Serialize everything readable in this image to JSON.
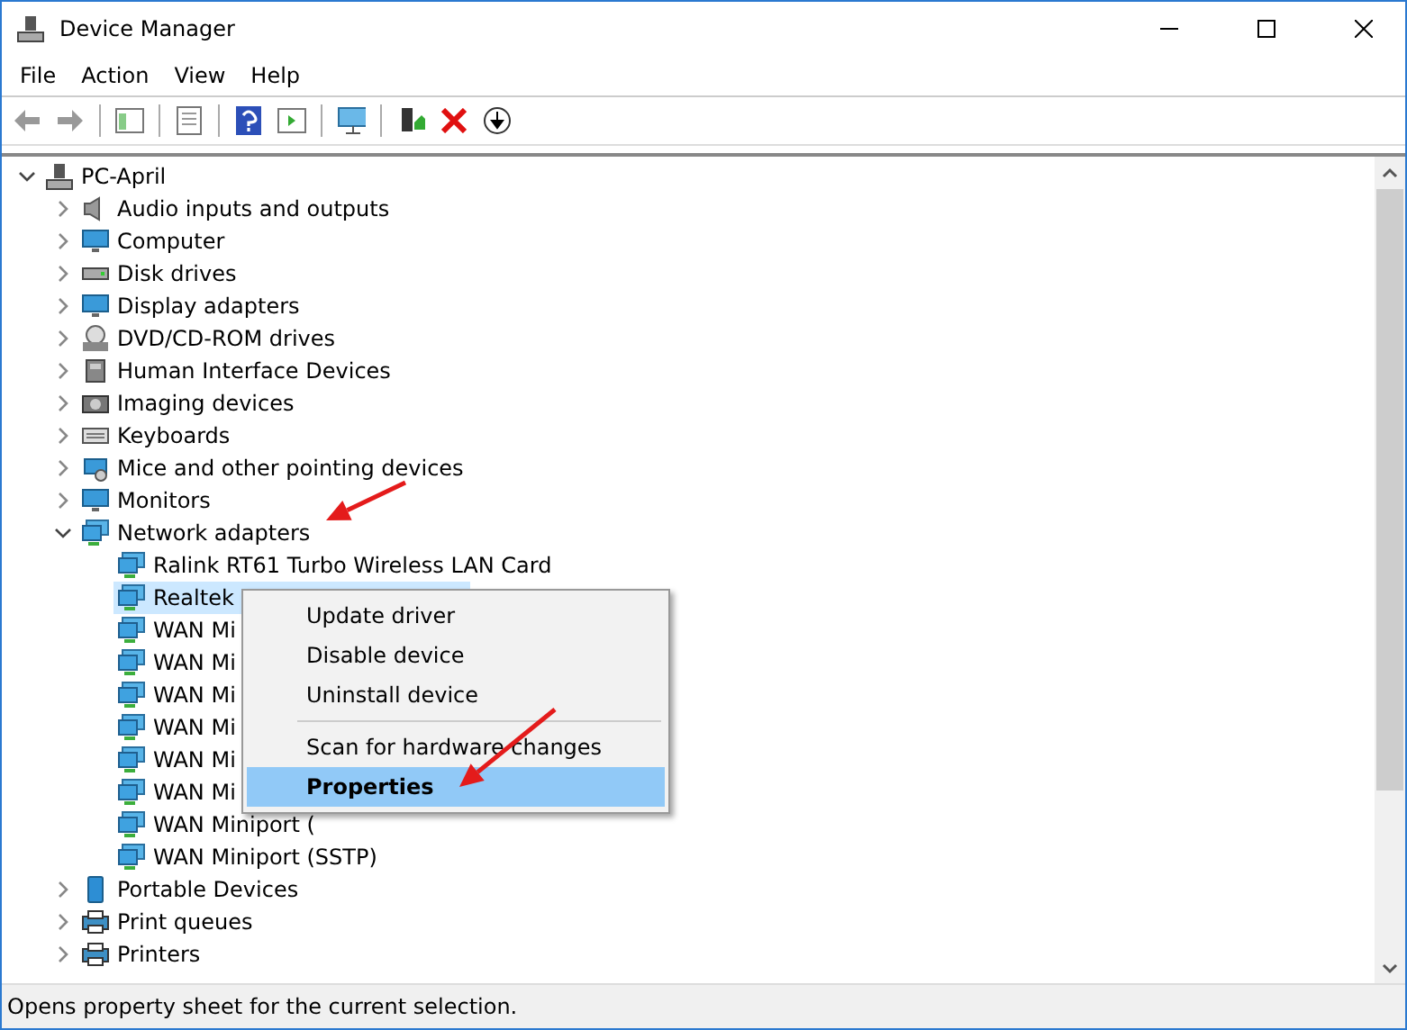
{
  "window": {
    "title": "Device Manager"
  },
  "menu": [
    "File",
    "Action",
    "View",
    "Help"
  ],
  "tree": [
    {
      "label": "PC-April",
      "expanded": true,
      "selected": false,
      "children": [
        {
          "label": "Audio inputs and outputs",
          "expanded": false,
          "selected": false
        },
        {
          "label": "Computer",
          "expanded": false,
          "selected": false
        },
        {
          "label": "Disk drives",
          "expanded": false,
          "selected": false
        },
        {
          "label": "Display adapters",
          "expanded": false,
          "selected": false
        },
        {
          "label": "DVD/CD-ROM drives",
          "expanded": false,
          "selected": false
        },
        {
          "label": "Human Interface Devices",
          "expanded": false,
          "selected": false
        },
        {
          "label": "Imaging devices",
          "expanded": false,
          "selected": false
        },
        {
          "label": "Keyboards",
          "expanded": false,
          "selected": false
        },
        {
          "label": "Mice and other pointing devices",
          "expanded": false,
          "selected": false
        },
        {
          "label": "Monitors",
          "expanded": false,
          "selected": false
        },
        {
          "label": "Network adapters",
          "expanded": true,
          "selected": false,
          "children": [
            {
              "label": "Ralink RT61 Turbo Wireless LAN Card",
              "selected": false
            },
            {
              "label": "Realtek",
              "selected": true
            },
            {
              "label": "WAN Mi",
              "selected": false
            },
            {
              "label": "WAN Mi",
              "selected": false
            },
            {
              "label": "WAN Mi",
              "selected": false
            },
            {
              "label": "WAN Mi",
              "selected": false
            },
            {
              "label": "WAN Mi",
              "selected": false
            },
            {
              "label": "WAN Mi",
              "selected": false
            },
            {
              "label": "WAN Miniport (",
              "selected": false
            },
            {
              "label": "WAN Miniport (SSTP)",
              "selected": false
            }
          ]
        },
        {
          "label": "Portable Devices",
          "expanded": false,
          "selected": false
        },
        {
          "label": "Print queues",
          "expanded": false,
          "selected": false
        },
        {
          "label": "Printers",
          "expanded": false,
          "selected": false
        }
      ]
    }
  ],
  "context_menu": [
    {
      "label": "Update driver",
      "selected": false,
      "default": false,
      "separator_before": false
    },
    {
      "label": "Disable device",
      "selected": false,
      "default": false,
      "separator_before": false
    },
    {
      "label": "Uninstall device",
      "selected": false,
      "default": false,
      "separator_before": false
    },
    {
      "label": "Scan for hardware changes",
      "selected": false,
      "default": false,
      "separator_before": true
    },
    {
      "label": "Properties",
      "selected": true,
      "default": true,
      "separator_before": false
    }
  ],
  "status_bar": "Opens property sheet for the current selection."
}
